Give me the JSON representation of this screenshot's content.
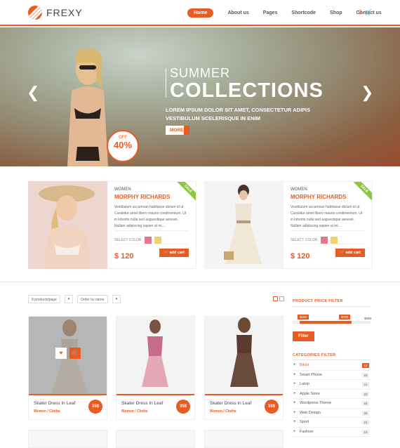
{
  "brand": {
    "name": "FREXY",
    "accent": "#e85c24"
  },
  "nav": {
    "items": [
      "Home",
      "About us",
      "Pages",
      "Shortcode",
      "Shop",
      "Contact us"
    ],
    "active": "Home"
  },
  "hero": {
    "title_line1": "SUMMER",
    "title_line2": "COLLECTIONS",
    "subtitle": "LOREM IPSUM DOLOR SIT AMET, CONSECTETUR ADIPIS VESTIBULUM SCELERISQUE IN ENIM",
    "more_label": "MORE",
    "badge_small": "OFF",
    "badge_big": "40%"
  },
  "featured": [
    {
      "category": "WOMEN",
      "title": "MORPHY RICHARDS",
      "ribbon": "SALE",
      "description": "Vestibulum accumsan habitasse dictum id ut Curabitur amet libero mauris condimentum. Ut in lobortis nulla sed auguestique aenean. Nullam adipiscing sapien ut mi....",
      "color_label": "SELECT COLOR",
      "colors": [
        "#e8758f",
        "#f2d06b"
      ],
      "price": "$ 120",
      "cart_label": "add cart"
    },
    {
      "category": "WOMEN",
      "title": "MORPHY RICHARDS",
      "ribbon": "SALE",
      "description": "Vestibulum accumsan habitasse dictum id ut Curabitur amet libero mauris condimentum. Ut in lobortis nulla sed auguestique aenean. Nullam adipiscing sapien ut mi....",
      "color_label": "SELECT COLOR",
      "colors": [
        "#e8758f",
        "#f2d06b"
      ],
      "price": "$ 120",
      "cart_label": "add cart"
    }
  ],
  "toolbar": {
    "per_page": "9 products/page",
    "order": "Order by name"
  },
  "products": [
    {
      "name": "Skater Dress In Leaf",
      "category": "Women / Clothe",
      "price": "35$"
    },
    {
      "name": "Skater Dress In Leaf",
      "category": "Women / Clothe",
      "price": "35$"
    },
    {
      "name": "Skater Dress In Leaf",
      "category": "Women / Clothe",
      "price": "35$"
    }
  ],
  "sidebar": {
    "price_filter_title": "PRODUCT PRICE FILTER",
    "min_tag": "$100",
    "max_tag": "$700",
    "max_value": "$999",
    "filter_button": "Filter",
    "categories_title": "CATEGORIES FILTER",
    "categories": [
      {
        "name": "Bikini",
        "count": "12",
        "active": true
      },
      {
        "name": "Smart Phone",
        "count": "23",
        "active": false
      },
      {
        "name": "Latop",
        "count": "11",
        "active": false
      },
      {
        "name": "Apple Store",
        "count": "23",
        "active": false
      },
      {
        "name": "Wordpress Theme",
        "count": "24",
        "active": false
      },
      {
        "name": "Web Design",
        "count": "26",
        "active": false
      },
      {
        "name": "Sport",
        "count": "21",
        "active": false
      },
      {
        "name": "Fashion",
        "count": "16",
        "active": false
      }
    ]
  }
}
